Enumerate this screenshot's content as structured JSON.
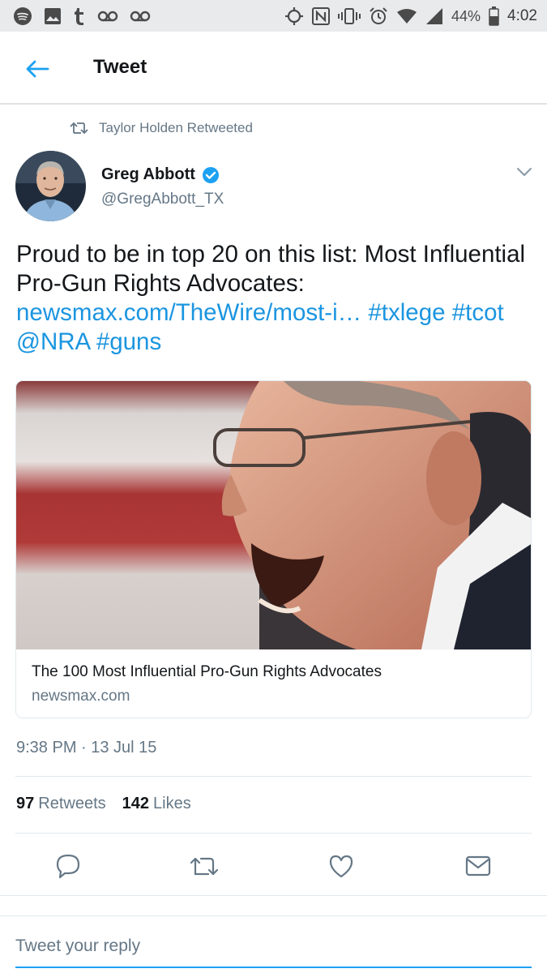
{
  "status_bar": {
    "left_icons": [
      "spotify-icon",
      "gallery-icon",
      "tumblr-icon",
      "voicemail-icon",
      "voicemail-icon"
    ],
    "right_icons": [
      "location-icon",
      "nfc-icon",
      "vibrate-icon",
      "alarm-icon",
      "wifi-icon",
      "signal-icon"
    ],
    "battery": "44%",
    "time": "4:02"
  },
  "header": {
    "title": "Tweet"
  },
  "retweet_context": {
    "text": "Taylor Holden Retweeted"
  },
  "author": {
    "name": "Greg Abbott",
    "handle": "@GregAbbott_TX",
    "verified": true
  },
  "tweet": {
    "text_plain": "Proud to be in top 20 on this list: Most Influential Pro-Gun Rights Advocates:",
    "link": "newsmax.com/TheWire/most-i…",
    "tags": [
      "#txlege",
      "#tcot",
      "@NRA",
      "#guns"
    ]
  },
  "card": {
    "title": "The 100 Most Influential Pro-Gun Rights Advocates",
    "domain": "newsmax.com"
  },
  "timestamp": "9:38 PM · 13 Jul 15",
  "stats": {
    "retweets_count": "97",
    "retweets_label": "Retweets",
    "likes_count": "142",
    "likes_label": "Likes"
  },
  "actions": [
    "reply-icon",
    "retweet-icon",
    "like-icon",
    "message-icon"
  ],
  "reply": {
    "placeholder": "Tweet your reply"
  },
  "colors": {
    "accent": "#1da1f2",
    "link": "#1b95e0",
    "verified": "#1da1f2",
    "muted": "#657786"
  }
}
